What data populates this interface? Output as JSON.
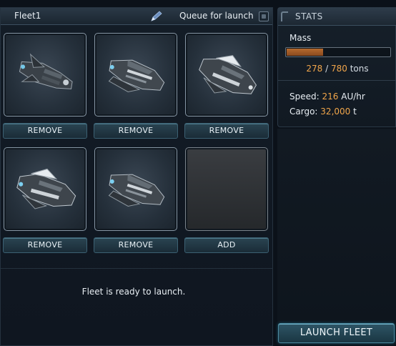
{
  "fleet": {
    "name": "Fleet1",
    "queue_label": "Queue for launch",
    "queue_checked": false,
    "slots": [
      {
        "kind": "ship",
        "button": "REMOVE"
      },
      {
        "kind": "ship",
        "button": "REMOVE"
      },
      {
        "kind": "ship",
        "button": "REMOVE"
      },
      {
        "kind": "ship",
        "button": "REMOVE"
      },
      {
        "kind": "ship",
        "button": "REMOVE"
      },
      {
        "kind": "empty",
        "button": "ADD"
      }
    ],
    "status": "Fleet is ready to launch."
  },
  "stats": {
    "title": "STATS",
    "mass": {
      "label": "Mass",
      "current": "278",
      "separator": "/",
      "max": "780",
      "unit": "tons",
      "fill_fraction": 0.356
    },
    "speed": {
      "label": "Speed:",
      "value": "216",
      "unit": "AU/hr"
    },
    "cargo": {
      "label": "Cargo:",
      "value": "32,000",
      "unit": "t"
    }
  },
  "launch_button": "LAUNCH FLEET",
  "colors": {
    "accent": "#f0a54a",
    "button": "#2a4452",
    "mass_bar": "#b56a2e"
  }
}
